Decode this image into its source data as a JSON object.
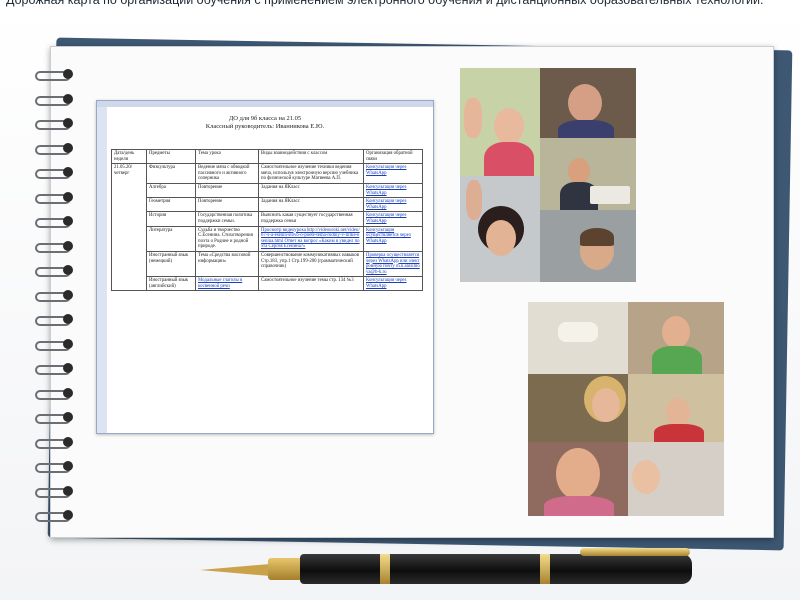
{
  "header": {
    "text": "Дорожная карта по организации обучения с применением электронного обучения и дистанционных образовательных технологий."
  },
  "document": {
    "title_line1": "ДО для 9б класса на 21.05",
    "title_line2": "Классный руководитель: Иванникова Е.Ю.",
    "columns": [
      "Дата/день недели",
      "Предметы",
      "Тема урока",
      "Виды взаимодействия с классом",
      "Организация обратной связи"
    ],
    "date_cell": "21.05.20/ четверг",
    "rows": [
      {
        "subject": "Физкультура",
        "topic": "Ведение мяча с обводкой пассивного и активного соперника",
        "interaction": "Самостоятельное изучение техники ведения мяча, используя электронную версию учебника по физической культуре Матвеева А.П.",
        "feedback": "Консультация через WhatsApp"
      },
      {
        "subject": "Алгебра",
        "topic": "Повторение",
        "interaction": "Задания на ЯКласс",
        "feedback": "Консультация через WhatsApp"
      },
      {
        "subject": "Геометрия",
        "topic": "Повторение",
        "interaction": "Задания на ЯКласс",
        "feedback": "Консультация через WhatsApp"
      },
      {
        "subject": "История",
        "topic": "Государственная политика поддержки семьи.",
        "interaction": "Выяснить какая существует государственная поддержка семьи",
        "feedback": "Консультация через WhatsApp"
      },
      {
        "subject": "Литература",
        "topic": "Судьба и творчество С.Есенина. Стихотворения поэта о Родине и родной природе.",
        "interaction": "Просмотр видеоурока http://videouroki.net/video/67-s-a-esenin-slovo-o-poete-tema-rodiny-v-lirike-esenina.html Ответ на вопрос «Каким я увидел поэта Сергея Есенина?»",
        "feedback": "Консультация осуществляется через WhatsApp"
      },
      {
        "subject": "Иностранный язык (немецкий)",
        "topic": "Тема «Средства массовой информации»",
        "interaction": "Совершенствование коммуникативных навыков Стр.183, упр.1 Стр.199-200 (грамматический справочник)",
        "feedback": "Проверка осуществляется через WhatsApp или электронную почту m.n.anisimova@b-k.ru"
      },
      {
        "subject": "Иностранный язык (английский)",
        "topic": "Модальные глаголы в косвенной речи",
        "interaction": "Самостоятельное изучение темы стр. 134 №3",
        "feedback": "Консультация через WhatsApp"
      }
    ]
  },
  "collage1": {
    "tiles": [
      {
        "name": "tile-girl-waving",
        "bg": "#c8d2a7"
      },
      {
        "name": "tile-teacher-glasses",
        "bg": "#6c5a4a"
      },
      {
        "name": "tile-boy-laptop",
        "bg": "#b9b59a"
      },
      {
        "name": "tile-girl-hand",
        "bg": "#c5c9cc"
      },
      {
        "name": "tile-boy-cap",
        "bg": "#9aa0a1"
      }
    ]
  },
  "collage2": {
    "tiles": [
      {
        "name": "tile-room-ceiling",
        "bg": "#e2ddd2"
      },
      {
        "name": "tile-boy-green-shirt",
        "bg": "#b7a488"
      },
      {
        "name": "tile-woman-blonde",
        "bg": "#7d6b50"
      },
      {
        "name": "tile-boy-red-shirt",
        "bg": "#cfc1a0"
      },
      {
        "name": "tile-woman-glasses",
        "bg": "#8f6a5e"
      },
      {
        "name": "tile-child-smiling",
        "bg": "#d6cfc7"
      }
    ]
  }
}
